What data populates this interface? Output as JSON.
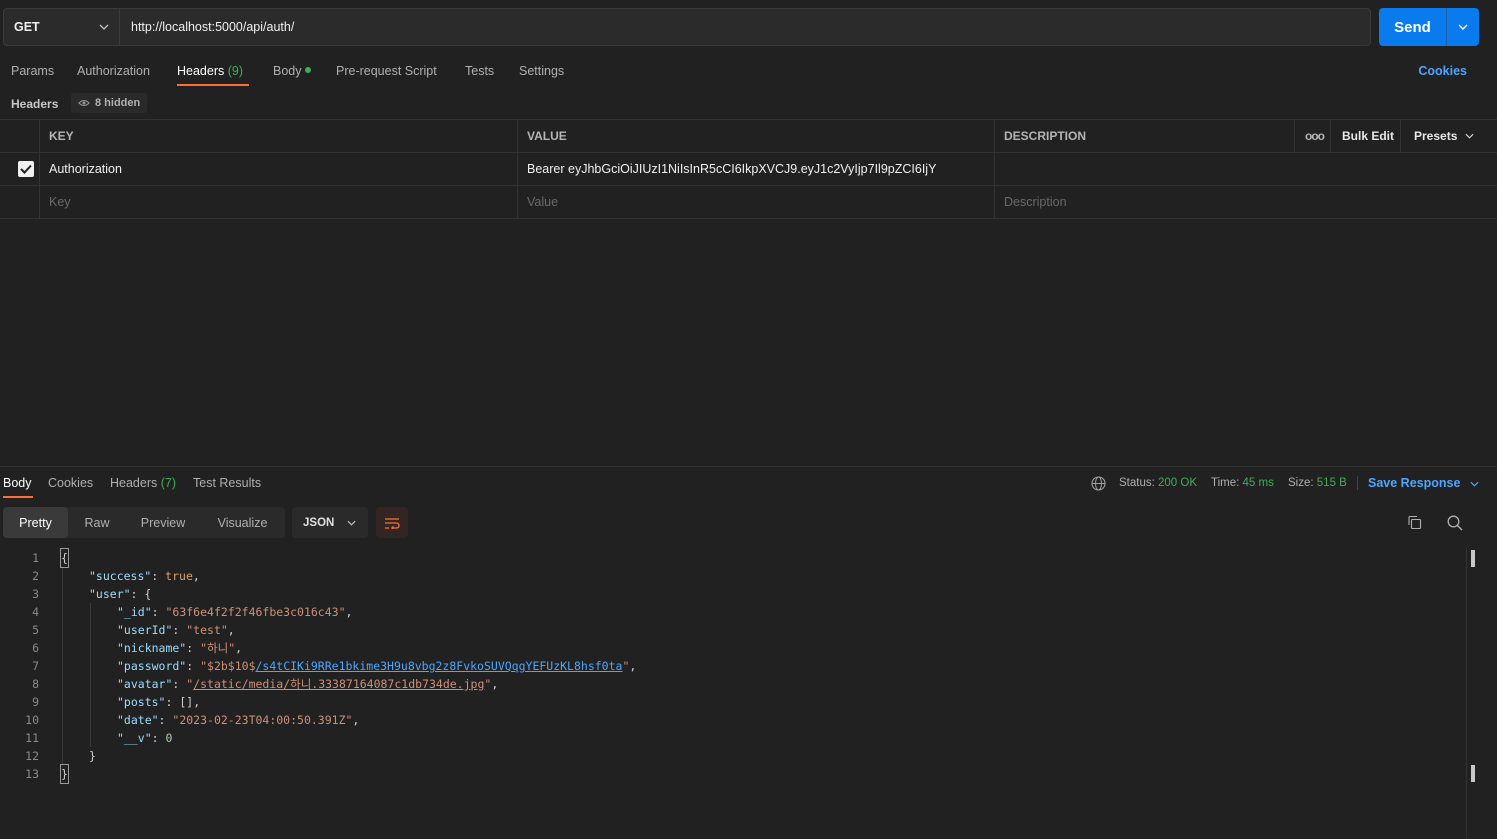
{
  "request": {
    "method": "GET",
    "url": "http://localhost:5000/api/auth/",
    "send_label": "Send"
  },
  "tabs": [
    {
      "label": "Params"
    },
    {
      "label": "Authorization"
    },
    {
      "label": "Headers",
      "count": "(9)"
    },
    {
      "label": "Body"
    },
    {
      "label": "Pre-request Script"
    },
    {
      "label": "Tests"
    },
    {
      "label": "Settings"
    }
  ],
  "cookies_label": "Cookies",
  "headers_section": {
    "title": "Headers",
    "hidden_label": "8 hidden",
    "columns": {
      "key": "KEY",
      "value": "VALUE",
      "description": "DESCRIPTION",
      "more": "ooo",
      "bulk_edit": "Bulk Edit",
      "presets": "Presets"
    },
    "rows": [
      {
        "key": "Authorization",
        "value": "Bearer eyJhbGciOiJIUzI1NiIsInR5cCI6IkpXVCJ9.eyJ1c2VyIjp7Il9pZCI6IjY",
        "description": ""
      }
    ],
    "placeholders": {
      "key": "Key",
      "value": "Value",
      "description": "Description"
    }
  },
  "response": {
    "tabs": [
      {
        "label": "Body"
      },
      {
        "label": "Cookies"
      },
      {
        "label": "Headers",
        "count": "(7)"
      },
      {
        "label": "Test Results"
      }
    ],
    "status_label": "Status:",
    "status_value": "200 OK",
    "time_label": "Time:",
    "time_value": "45 ms",
    "size_label": "Size:",
    "size_value": "515 B",
    "save_label": "Save Response",
    "views": [
      "Pretty",
      "Raw",
      "Preview",
      "Visualize"
    ],
    "format": "JSON",
    "line_numbers": [
      "1",
      "2",
      "3",
      "4",
      "5",
      "6",
      "7",
      "8",
      "9",
      "10",
      "11",
      "12",
      "13"
    ],
    "code": {
      "l1": "{",
      "success_key": "\"success\"",
      "success_val": "true",
      "user_key": "\"user\"",
      "id_key": "\"_id\"",
      "id_val": "\"63f6e4f2f2f46fbe3c016c43\"",
      "userId_key": "\"userId\"",
      "userId_val": "\"test\"",
      "nickname_key": "\"nickname\"",
      "nickname_val": "\"하니\"",
      "password_key": "\"password\"",
      "password_pre": "\"$2b$10$",
      "password_link": "/s4tCIKi9RRe1bkime3H9u8vbg2z8FvkoSUVQqgYEFUzKL8hsf0ta",
      "password_post": "\"",
      "avatar_key": "\"avatar\"",
      "avatar_pre": "\"",
      "avatar_link": "/static/media/하니.33387164087c1db734de.jpg",
      "avatar_post": "\"",
      "posts_key": "\"posts\"",
      "posts_val": "[]",
      "date_key": "\"date\"",
      "date_val": "\"2023-02-23T04:00:50.391Z\"",
      "v_key": "\"__v\"",
      "v_val": "0",
      "l12": "}",
      "l13": "}"
    }
  }
}
